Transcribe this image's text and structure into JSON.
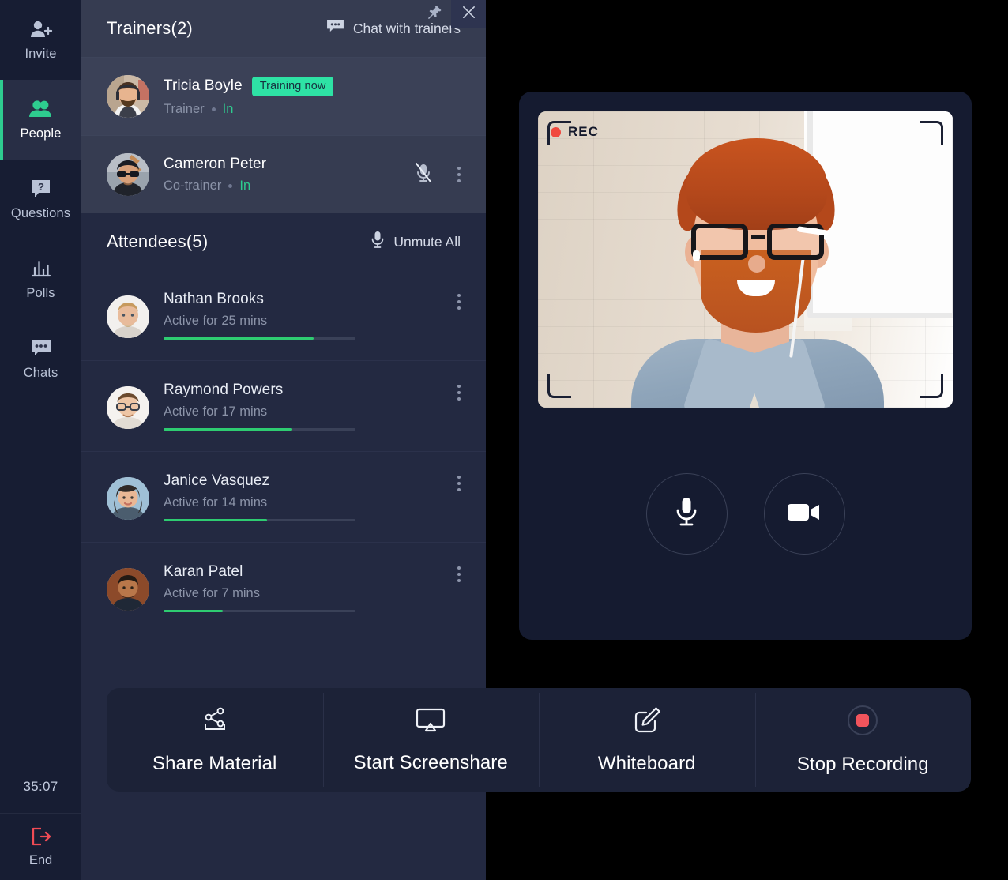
{
  "sidebar": {
    "items": [
      {
        "icon": "invite-icon",
        "label": "Invite",
        "active": false
      },
      {
        "icon": "people-icon",
        "label": "People",
        "active": true
      },
      {
        "icon": "questions-icon",
        "label": "Questions",
        "active": false
      },
      {
        "icon": "polls-icon",
        "label": "Polls",
        "active": false
      },
      {
        "icon": "chats-icon",
        "label": "Chats",
        "active": false
      }
    ],
    "timer": "35:07",
    "end_label": "End"
  },
  "panel": {
    "pin_icon": "pin-icon",
    "close_icon": "close-icon",
    "trainers": {
      "title": "Trainers(2)",
      "action_label": "Chat with trainers",
      "action_icon": "chat-icon",
      "people": [
        {
          "name": "Tricia Boyle",
          "badge": "Training now",
          "role": "Trainer",
          "state": "In",
          "highlighted": true,
          "muted": false,
          "has_kebab": false
        },
        {
          "name": "Cameron Peter",
          "badge": "",
          "role": "Co-trainer",
          "state": "In",
          "highlighted": false,
          "muted": true,
          "has_kebab": true
        }
      ]
    },
    "attendees": {
      "title": "Attendees(5)",
      "action_label": "Unmute All",
      "action_icon": "microphone-icon",
      "people": [
        {
          "name": "Nathan Brooks",
          "status": "Active for 25 mins",
          "progress_percent": 78
        },
        {
          "name": "Raymond Powers",
          "status": "Active for 17 mins",
          "progress_percent": 67
        },
        {
          "name": "Janice Vasquez",
          "status": "Active for 14 mins",
          "progress_percent": 54
        },
        {
          "name": "Karan Patel",
          "status": "Active for 7 mins",
          "progress_percent": 31
        }
      ]
    }
  },
  "video": {
    "rec_label": "REC",
    "rec_dot_color": "#f0483e",
    "mic_button_icon": "microphone-icon",
    "camera_button_icon": "video-camera-icon"
  },
  "toolbar": {
    "buttons": [
      {
        "icon": "share-icon",
        "label": "Share Material"
      },
      {
        "icon": "screenshare-icon",
        "label": "Start Screenshare"
      },
      {
        "icon": "whiteboard-icon",
        "label": "Whiteboard"
      },
      {
        "icon": "stop-record-icon",
        "label": "Stop Recording"
      }
    ]
  },
  "colors": {
    "accent_green": "#2ecc8f",
    "badge_green": "#2ee2a5",
    "danger_red": "#f0483e",
    "sidebar_bg": "#171d33",
    "panel_bg": "#232941",
    "trainers_bg": "#363c51",
    "toolbar_bg": "#1c2237",
    "video_card_bg": "#151b30"
  }
}
